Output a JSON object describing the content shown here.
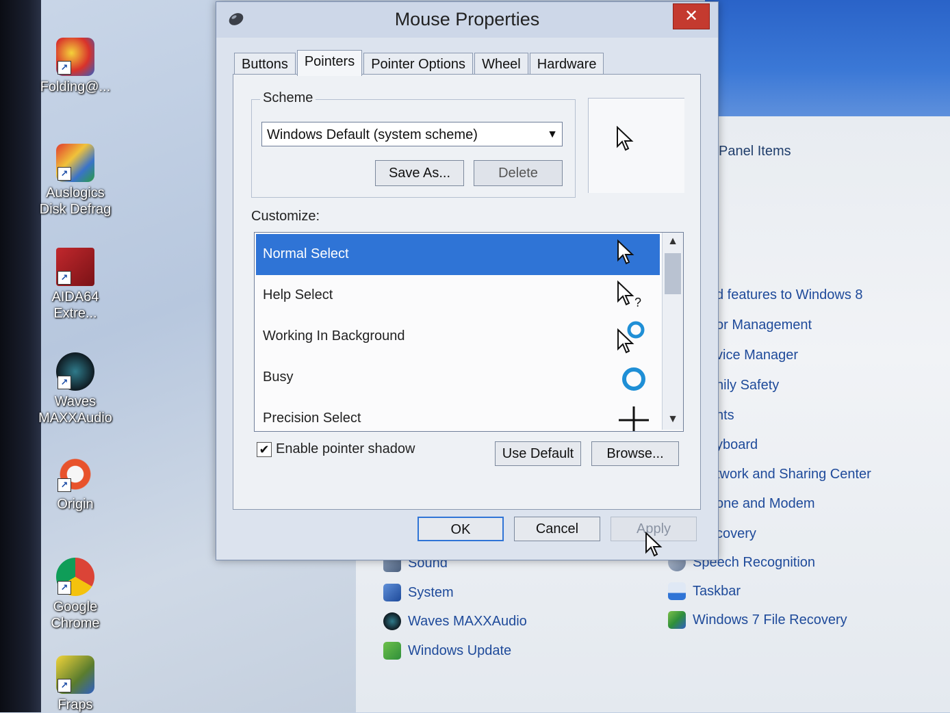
{
  "desktop": {
    "icons": [
      {
        "label_line1": "Folding@...",
        "label_line2": "",
        "color": "#d8322b"
      },
      {
        "label_line1": "Auslogics",
        "label_line2": "Disk Defrag",
        "color": "#3a73c9"
      },
      {
        "label_line1": "AIDA64",
        "label_line2": "Extre...",
        "color": "#c1282d"
      },
      {
        "label_line1": "Waves",
        "label_line2": "MAXXAudio",
        "color": "#1b2d36"
      },
      {
        "label_line1": "Origin",
        "label_line2": "",
        "color": "#e8532c"
      },
      {
        "label_line1": "Google",
        "label_line2": "Chrome",
        "color": "#f2b51b"
      },
      {
        "label_line1": "Fraps",
        "label_line2": "",
        "color": "#5a7c2e"
      }
    ]
  },
  "control_panel": {
    "title_fragment": "l Panel Items",
    "items_right": [
      "d features to Windows 8",
      "or Management",
      "vice Manager",
      "nily Safety",
      "nts",
      "yboard",
      "twork and Sharing Center",
      "one and Modem",
      "covery"
    ],
    "bottom_left": [
      "Sound",
      "System",
      "Waves MAXXAudio",
      "Windows Update"
    ],
    "bottom_right": [
      "Speech Recognition",
      "Taskbar",
      "Windows 7 File Recovery"
    ]
  },
  "dialog": {
    "title": "Mouse Properties",
    "close": "✕",
    "tabs": [
      "Buttons",
      "Pointers",
      "Pointer Options",
      "Wheel",
      "Hardware"
    ],
    "active_tab": "Pointers",
    "scheme": {
      "label": "Scheme",
      "value": "Windows Default (system scheme)",
      "save_as": "Save As...",
      "delete": "Delete"
    },
    "customize_label": "Customize:",
    "pointers": [
      {
        "name": "Normal Select",
        "icon": "arrow-cursor-icon",
        "selected": true
      },
      {
        "name": "Help Select",
        "icon": "help-cursor-icon",
        "selected": false
      },
      {
        "name": "Working In Background",
        "icon": "working-cursor-icon",
        "selected": false
      },
      {
        "name": "Busy",
        "icon": "busy-cursor-icon",
        "selected": false
      },
      {
        "name": "Precision Select",
        "icon": "crosshair-cursor-icon",
        "selected": false
      }
    ],
    "enable_shadow_label": "Enable pointer shadow",
    "enable_shadow_checked": true,
    "check_mark": "✔",
    "use_default": "Use Default",
    "browse": "Browse...",
    "ok": "OK",
    "cancel": "Cancel",
    "apply": "Apply",
    "scroll_up": "▲",
    "scroll_down": "▼",
    "combo_arrow": "▼"
  }
}
